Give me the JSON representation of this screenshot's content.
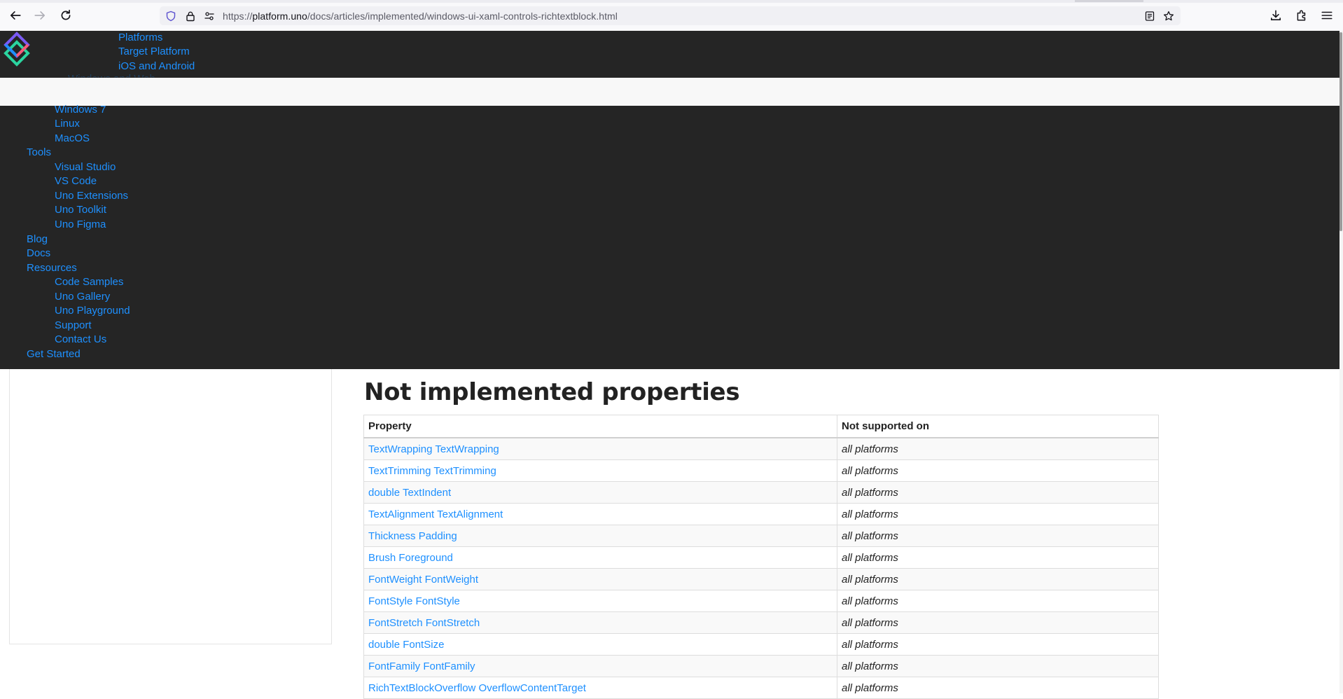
{
  "browser": {
    "url_prefix": "https://",
    "url_host": "platform.uno",
    "url_path": "/docs/articles/implemented/windows-ui-xaml-controls-richtextblock.html"
  },
  "nav": {
    "submenu_top": [
      "Platforms",
      "Target Platform",
      "iOS and Android"
    ],
    "hidden_text": "Windows and Web",
    "platform_items": [
      "Windows 7",
      "Linux",
      "MacOS"
    ],
    "tools_label": "Tools",
    "tools_items": [
      "Visual Studio",
      "VS Code",
      "Uno Extensions",
      "Uno Toolkit",
      "Uno Figma"
    ],
    "blog_label": "Blog",
    "docs_label": "Docs",
    "resources_label": "Resources",
    "resources_items": [
      "Code Samples",
      "Uno Gallery",
      "Uno Playground",
      "Support",
      "Contact Us"
    ],
    "get_started_label": "Get Started"
  },
  "content": {
    "heading": "Not implemented properties",
    "columns": [
      "Property",
      "Not supported on"
    ],
    "rows": [
      {
        "property": "TextWrapping TextWrapping",
        "platforms": "all platforms"
      },
      {
        "property": "TextTrimming TextTrimming",
        "platforms": "all platforms"
      },
      {
        "property": "double TextIndent",
        "platforms": "all platforms"
      },
      {
        "property": "TextAlignment TextAlignment",
        "platforms": "all platforms"
      },
      {
        "property": "Thickness Padding",
        "platforms": "all platforms"
      },
      {
        "property": "Brush Foreground",
        "platforms": "all platforms"
      },
      {
        "property": "FontWeight FontWeight",
        "platforms": "all platforms"
      },
      {
        "property": "FontStyle FontStyle",
        "platforms": "all platforms"
      },
      {
        "property": "FontStretch FontStretch",
        "platforms": "all platforms"
      },
      {
        "property": "double FontSize",
        "platforms": "all platforms"
      },
      {
        "property": "FontFamily FontFamily",
        "platforms": "all platforms"
      },
      {
        "property": "RichTextBlockOverflow OverflowContentTarget",
        "platforms": "all platforms"
      }
    ]
  },
  "colors": {
    "nav_background": "#252525",
    "link": "#1e90ff",
    "overlay_bar": "#f8f8f8"
  },
  "icons": {
    "back": "arrow-left-icon",
    "forward": "arrow-right-icon",
    "reload": "reload-icon",
    "tracking": "shield-icon",
    "secure": "lock-icon",
    "permissions": "permissions-icon",
    "reader": "reader-view-icon",
    "bookmark": "star-icon",
    "downloads": "download-icon",
    "extensions": "puzzle-icon",
    "menu": "hamburger-menu-icon",
    "logo": "uno-logo-icon"
  }
}
